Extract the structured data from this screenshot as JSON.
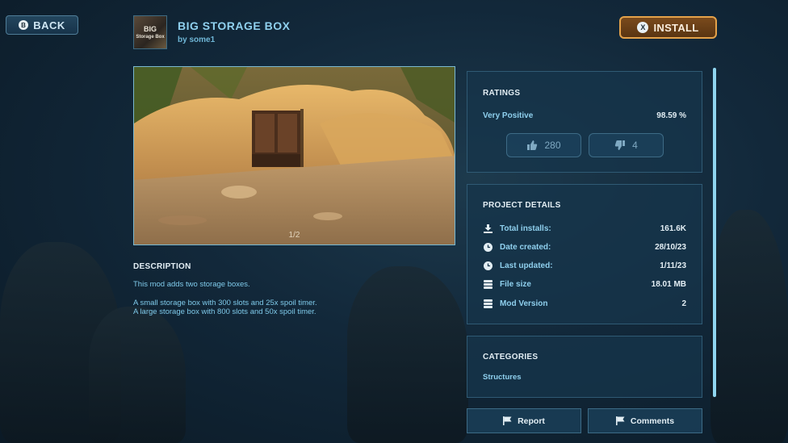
{
  "nav": {
    "back_label": "BACK",
    "back_glyph": "B"
  },
  "mod": {
    "thumb_line1": "BIG",
    "thumb_line2": "Storage Box",
    "title": "BIG STORAGE BOX",
    "author": "by some1"
  },
  "install": {
    "label": "INSTALL",
    "glyph": "X"
  },
  "gallery": {
    "counter": "1/2"
  },
  "description": {
    "heading": "DESCRIPTION",
    "line1": "This mod adds two storage boxes.",
    "line2": "A small storage box with 300 slots and 25x spoil timer.",
    "line3": "A large storage box with 800 slots and 50x spoil timer."
  },
  "ratings": {
    "heading": "RATINGS",
    "label": "Very Positive",
    "percent": "98.59 %",
    "upvotes": "280",
    "downvotes": "4"
  },
  "details": {
    "heading": "PROJECT DETAILS",
    "rows": [
      {
        "label": "Total installs:",
        "value": "161.6K",
        "icon": "download-icon"
      },
      {
        "label": "Date created:",
        "value": "28/10/23",
        "icon": "clock-icon"
      },
      {
        "label": "Last updated:",
        "value": "1/11/23",
        "icon": "clock-icon"
      },
      {
        "label": "File size",
        "value": "18.01 MB",
        "icon": "database-icon"
      },
      {
        "label": "Mod Version",
        "value": "2",
        "icon": "database-icon"
      }
    ]
  },
  "categories": {
    "heading": "CATEGORIES",
    "items": [
      "Structures"
    ]
  },
  "actions": {
    "report_label": "Report",
    "comments_label": "Comments"
  },
  "colors": {
    "accent": "#8fd0ee",
    "install_border": "#e4a24a",
    "panel_bg": "#16344a"
  }
}
